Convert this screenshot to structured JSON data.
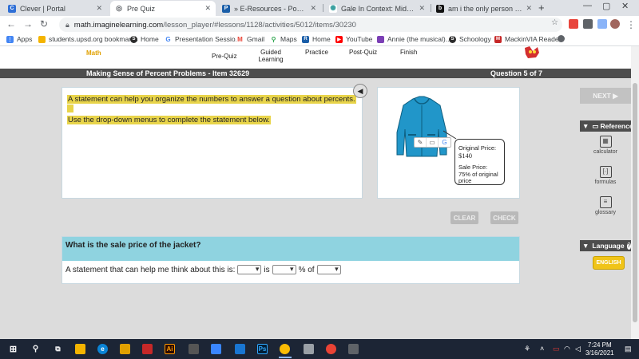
{
  "browser": {
    "tabs": [
      {
        "title": "Clever | Portal",
        "icon": "clever-icon",
        "color": "#2f6fd6",
        "glyph": "C",
        "active": false
      },
      {
        "title": "Pre Quiz",
        "icon": "globe-icon",
        "color": "#5f6368",
        "glyph": "◎",
        "active": true
      },
      {
        "title": "» E-Resources - Power Library",
        "icon": "power-library-icon",
        "color": "#1a5ea8",
        "glyph": "P",
        "active": false
      },
      {
        "title": "Gale In Context: Middle School",
        "icon": "gale-icon",
        "color": "#3aa0a0",
        "glyph": "✺",
        "active": false
      },
      {
        "title": "am i the only person that give",
        "icon": "brainly-icon",
        "color": "#111111",
        "glyph": "b",
        "active": false
      }
    ],
    "url_host": "math.imaginelearning.com",
    "url_path": "/lesson_player/#lessons/1128/activities/5012/items/30230",
    "bookmarks": [
      {
        "label": "Apps",
        "icon": "apps-grid-icon",
        "color": "#4285f4"
      },
      {
        "label": "students.upsd.org bookmarks",
        "icon": "folder-icon",
        "color": "#f4b400"
      },
      {
        "label": "Home",
        "icon": "schoology-icon",
        "color": "#2d2d2d"
      },
      {
        "label": "Presentation Sessio...",
        "icon": "google-icon",
        "color": "#4285f4"
      },
      {
        "label": "Gmail",
        "icon": "gmail-icon",
        "color": "#ea4335"
      },
      {
        "label": "Maps",
        "icon": "maps-icon",
        "color": "#34a853"
      },
      {
        "label": "Home",
        "icon": "renaissance-icon",
        "color": "#1a5ea8"
      },
      {
        "label": "YouTube",
        "icon": "youtube-icon",
        "color": "#ff0000"
      },
      {
        "label": "Annie (the musical)...",
        "icon": "bookmark-purple-icon",
        "color": "#7b3fb5"
      },
      {
        "label": "Schoology",
        "icon": "schoology-icon",
        "color": "#2d2d2d"
      },
      {
        "label": "MackinVIA Reader",
        "icon": "mackinvia-icon",
        "color": "#c62828"
      }
    ]
  },
  "app": {
    "steps": [
      "Math",
      "Pre-Quiz",
      "Guided Learning",
      "Practice",
      "Post-Quiz",
      "Finish"
    ],
    "title": "Making Sense of Percent Problems - Item 32629",
    "question_counter": "Question 5 of 7",
    "instruction_1": "A statement can help you organize the numbers to answer a question about percents.",
    "instruction_2": "Use the drop-down menus to complete the statement below.",
    "callout": {
      "orig_label": "Original Price:",
      "orig_value": "$140",
      "sale_label": "Sale Price:",
      "sale_value_1": "75% of original",
      "sale_value_2": "price"
    },
    "clear_label": "CLEAR",
    "check_label": "CHECK",
    "next_label": "NEXT ▶",
    "question": "What is the sale price of the jacket?",
    "statement_prefix": "A statement that can help me think about this is:",
    "statement_is": "is",
    "statement_pct_of": "% of",
    "dropdowns": [
      "",
      "",
      ""
    ],
    "reference_label": "Reference",
    "reference_items": [
      "calculator",
      "formulas",
      "glossary"
    ],
    "language_label": "Language",
    "language_button": "ENGLISH"
  },
  "taskbar": {
    "time": "7:24 PM",
    "date": "3/16/2021"
  },
  "colors": {
    "highlight": "#e8d44a",
    "question_header": "#8fd3e0",
    "title_bar": "#4d4d4d",
    "jacket": "#2196c9",
    "english_button": "#f0c419"
  }
}
